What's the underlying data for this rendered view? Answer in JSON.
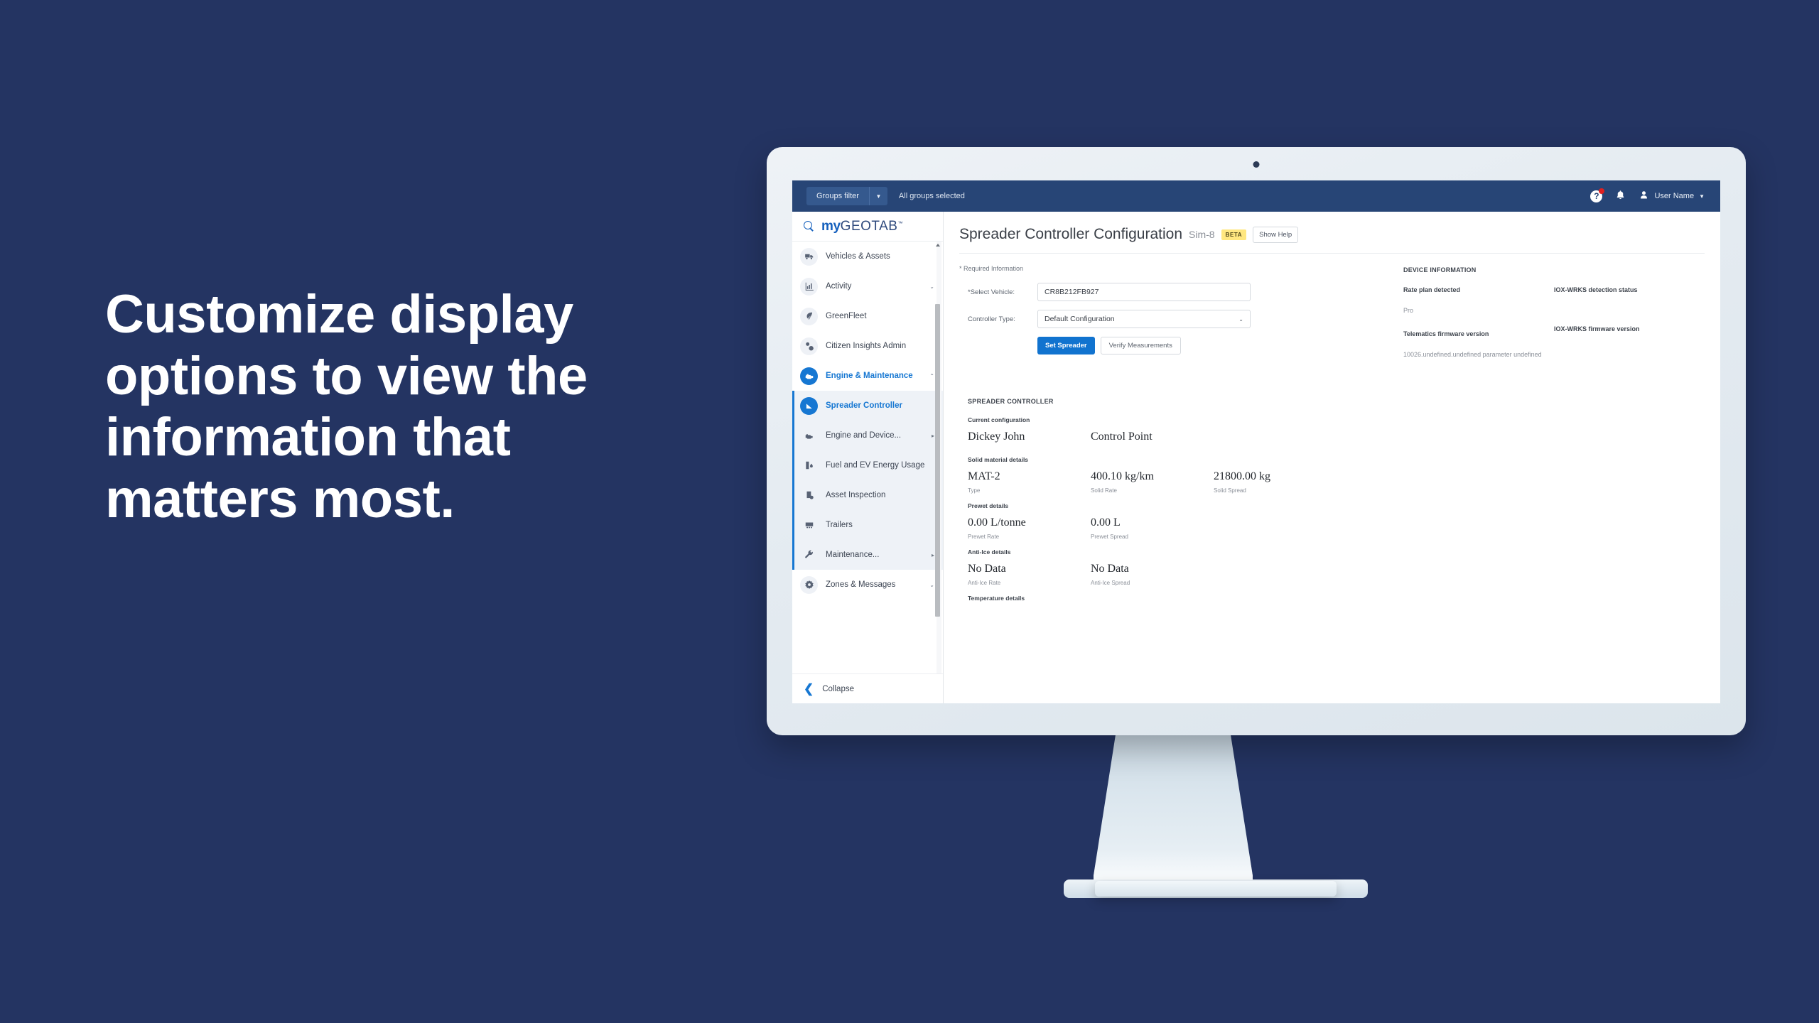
{
  "slide": {
    "headline_lines": [
      "Customize display",
      "options to view the",
      "information that",
      "matters most."
    ],
    "background_color": "#243462"
  },
  "appbar": {
    "groups_filter_label": "Groups filter",
    "groups_filter_caret": "▼",
    "groups_status": "All groups selected",
    "help_icon_glyph": "?",
    "bell_icon_glyph": "▲",
    "user_name": "User Name",
    "user_caret": "▼"
  },
  "sidebar": {
    "logo_my": "my",
    "logo_geotab": "GEOTAB",
    "logo_tm": "™",
    "items": [
      {
        "label": "Vehicles & Assets",
        "icon": "truck-icon",
        "caret": ""
      },
      {
        "label": "Activity",
        "icon": "chart-icon",
        "caret": "⌄"
      },
      {
        "label": "GreenFleet",
        "icon": "leaf-icon",
        "caret": ""
      },
      {
        "label": "Citizen Insights Admin",
        "icon": "recycle-icon",
        "caret": ""
      },
      {
        "label": "Engine & Maintenance",
        "icon": "engine-icon",
        "caret": "⌃"
      }
    ],
    "sub_items": [
      {
        "label": "Spreader Controller",
        "icon": "spreader-icon",
        "caret": ""
      },
      {
        "label": "Engine and Device...",
        "icon": "engine-block-icon",
        "caret": "▸"
      },
      {
        "label": "Fuel and EV Energy Usage",
        "icon": "fuel-icon",
        "caret": ""
      },
      {
        "label": "Asset Inspection",
        "icon": "clipboard-check-icon",
        "caret": ""
      },
      {
        "label": "Trailers",
        "icon": "trailer-icon",
        "caret": ""
      },
      {
        "label": "Maintenance...",
        "icon": "wrench-icon",
        "caret": "▸"
      }
    ],
    "footer_items": [
      {
        "label": "Zones & Messages",
        "icon": "zones-icon",
        "caret": "⌄"
      }
    ],
    "collapse_label": "Collapse",
    "collapse_chevron": "❮"
  },
  "page": {
    "title": "Spreader Controller Configuration",
    "subtitle": "Sim-8",
    "beta_badge": "BETA",
    "show_help_label": "Show Help",
    "required_note": "* Required Information",
    "fields": {
      "vehicle_label": "*Select Vehicle:",
      "vehicle_value": "CR8B212FB927",
      "controller_label": "Controller Type:",
      "controller_value": "Default Configuration",
      "select_caret": "⌄"
    },
    "buttons": {
      "set_spreader": "Set Spreader",
      "verify_measurements": "Verify Measurements"
    }
  },
  "device_information": {
    "caption": "DEVICE INFORMATION",
    "left": {
      "key1": "Rate plan detected",
      "val1": "Pro",
      "key2": "Telematics firmware version",
      "val2": "10026.undefined.undefined parameter undefined"
    },
    "right": {
      "key1": "IOX-WRKS detection status",
      "val1": "",
      "key2": "IOX-WRKS firmware version",
      "val2": ""
    }
  },
  "spreader_controller": {
    "caption": "SPREADER CONTROLLER",
    "groups": [
      {
        "title": "Current configuration",
        "cells": [
          {
            "value": "Dickey John",
            "label": ""
          },
          {
            "value": "Control Point",
            "label": ""
          },
          {
            "value": "",
            "label": ""
          }
        ]
      },
      {
        "title": "Solid material details",
        "cells": [
          {
            "value": "MAT-2",
            "label": "Type"
          },
          {
            "value": "400.10 kg/km",
            "label": "Solid Rate"
          },
          {
            "value": "21800.00 kg",
            "label": "Solid Spread"
          }
        ]
      },
      {
        "title": "Prewet details",
        "cells": [
          {
            "value": "0.00 L/tonne",
            "label": "Prewet Rate"
          },
          {
            "value": "0.00 L",
            "label": "Prewet Spread"
          },
          {
            "value": "",
            "label": ""
          }
        ]
      },
      {
        "title": "Anti-Ice details",
        "cells": [
          {
            "value": "No Data",
            "label": "Anti-Ice Rate"
          },
          {
            "value": "No Data",
            "label": "Anti-Ice Spread"
          },
          {
            "value": "",
            "label": ""
          }
        ]
      },
      {
        "title": "Temperature details",
        "cells": [
          {
            "value": "",
            "label": ""
          },
          {
            "value": "",
            "label": ""
          },
          {
            "value": "",
            "label": ""
          }
        ]
      }
    ]
  },
  "colors": {
    "brand_blue": "#1677d2",
    "appbar_blue": "#274576",
    "slide_bg": "#243462",
    "beta_yellow": "#ffe780",
    "alert_red": "#e02020"
  }
}
